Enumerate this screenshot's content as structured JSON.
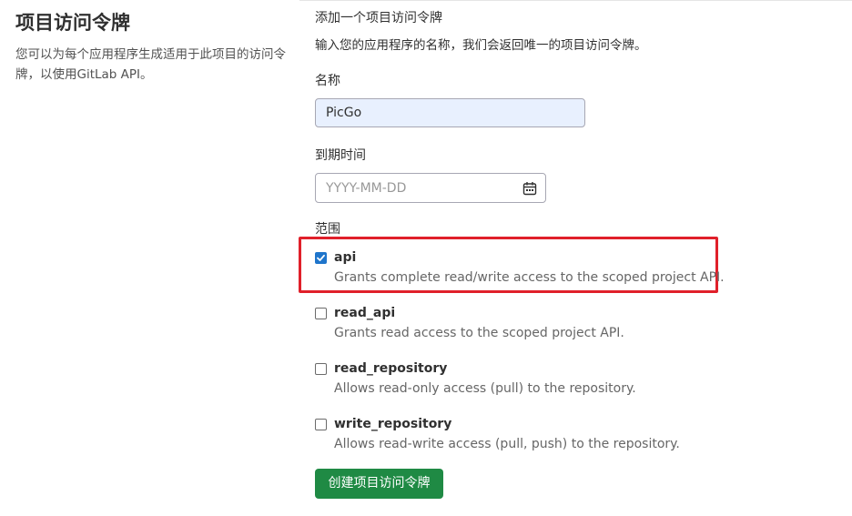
{
  "section": {
    "title": "项目访问令牌",
    "description": "您可以为每个应用程序生成适用于此项目的访问令牌，以使用GitLab API。"
  },
  "form": {
    "heading": "添加一个项目访问令牌",
    "help": "输入您的应用程序的名称，我们会返回唯一的项目访问令牌。",
    "name_label": "名称",
    "name_value": "PicGo",
    "expiry_label": "到期时间",
    "expiry_placeholder": "YYYY-MM-DD",
    "scopes_label": "范围",
    "scopes": [
      {
        "name": "api",
        "description": "Grants complete read/write access to the scoped project API.",
        "checked": true
      },
      {
        "name": "read_api",
        "description": "Grants read access to the scoped project API.",
        "checked": false
      },
      {
        "name": "read_repository",
        "description": "Allows read-only access (pull) to the repository.",
        "checked": false
      },
      {
        "name": "write_repository",
        "description": "Allows read-write access (pull, push) to the repository.",
        "checked": false
      }
    ],
    "submit_label": "创建项目访问令牌"
  },
  "colors": {
    "submit_bg": "#1f8a44",
    "highlight_border": "#e0202a",
    "checkbox_checked": "#1f75cb"
  },
  "icons": {
    "date": "calendar-icon",
    "check": "checkmark-icon"
  }
}
